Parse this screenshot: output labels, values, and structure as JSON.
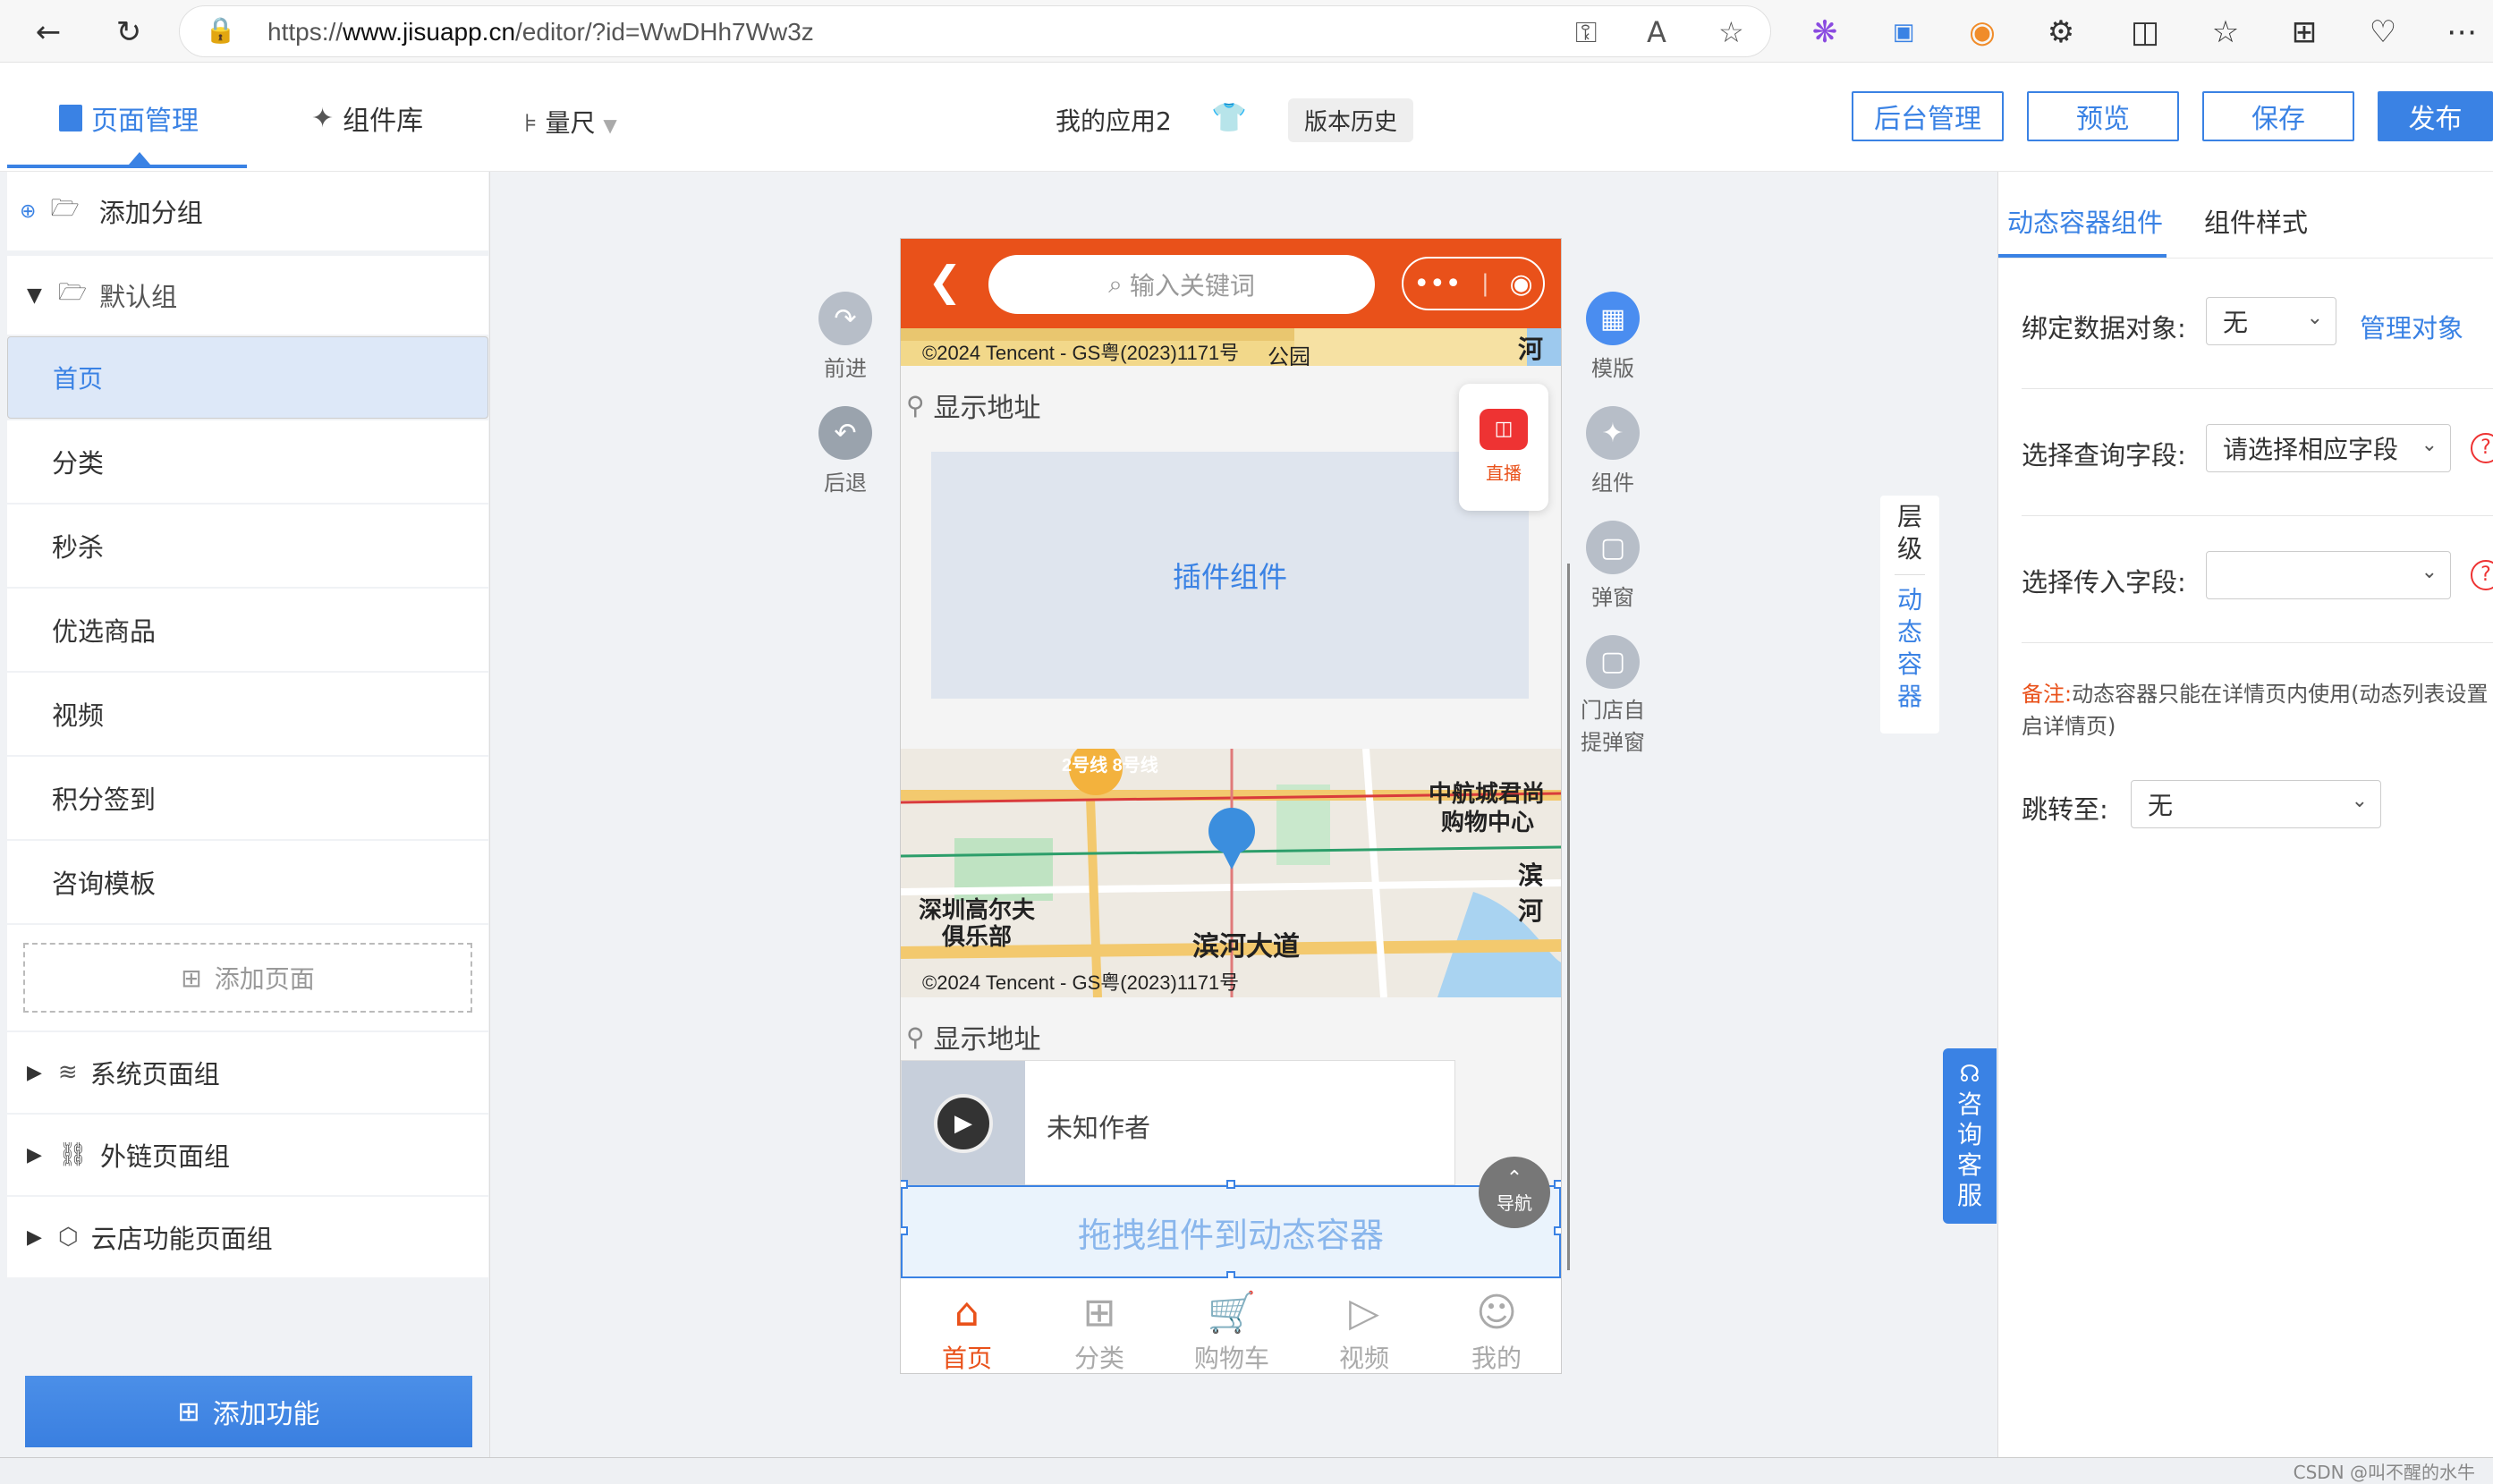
{
  "browser": {
    "url_prefix": "https://",
    "url_domain": "www.jisuapp.cn",
    "url_path": "/editor/?id=WwDHh7Ww3z"
  },
  "header": {
    "tabs": [
      {
        "label": "页面管理",
        "active": true
      },
      {
        "label": "组件库",
        "active": false
      }
    ],
    "ruler_label": "量尺",
    "app_name": "我的应用2",
    "version_history": "版本历史",
    "buttons": {
      "admin": "后台管理",
      "preview": "预览",
      "save": "保存",
      "publish": "发布"
    }
  },
  "left_panel": {
    "add_group": "添加分组",
    "default_group": "默认组",
    "pages": [
      "首页",
      "分类",
      "秒杀",
      "优选商品",
      "视频",
      "积分签到",
      "咨询模板"
    ],
    "selected_page": "首页",
    "add_page": "添加页面",
    "groups": [
      "系统页面组",
      "外链页面组",
      "云店功能页面组"
    ],
    "add_function": "添加功能"
  },
  "canvas": {
    "forward": "前进",
    "back": "后退",
    "template": "模版",
    "component": "组件",
    "popup": "弹窗",
    "store_popup_line1": "门店自",
    "store_popup_line2": "提弹窗",
    "layer": "层级",
    "dynamic_container_vertical": "动态容器",
    "consult_service": "咨询客服"
  },
  "phone": {
    "search_placeholder": "输入关键词",
    "map_copyright": "©2024 Tencent - GS粤(2023)1171号",
    "show_address": "显示地址",
    "plugin_component": "插件组件",
    "live_label": "直播",
    "map_labels": {
      "metro": "2号线 8号线",
      "mall_1": "中航城君尚",
      "mall_2": "购物中心",
      "golf_1": "深圳高尔夫",
      "golf_2": "俱乐部",
      "road": "滨河大道",
      "edge_right": "滨河",
      "edge_top": "河",
      "park": "公园"
    },
    "video_author": "未知作者",
    "dropzone": "拖拽组件到动态容器",
    "nav_label": "导航",
    "tabbar": [
      {
        "label": "首页",
        "icon": "home-icon",
        "active": true
      },
      {
        "label": "分类",
        "icon": "grid-icon",
        "active": false
      },
      {
        "label": "购物车",
        "icon": "cart-icon",
        "active": false
      },
      {
        "label": "视频",
        "icon": "video-icon",
        "active": false
      },
      {
        "label": "我的",
        "icon": "user-icon",
        "active": false
      }
    ]
  },
  "right_panel": {
    "tabs": [
      "动态容器组件",
      "组件样式"
    ],
    "bind_label": "绑定数据对象:",
    "bind_value": "无",
    "manage_object": "管理对象",
    "query_field_label": "选择查询字段:",
    "query_field_value": "请选择相应字段",
    "pass_field_label": "选择传入字段:",
    "pass_field_value": "",
    "note_label": "备注:",
    "note_text": "动态容器只能在详情页内使用(动态列表设置启详情页)",
    "jump_label": "跳转至:",
    "jump_value": "无"
  },
  "footer": {
    "watermark": "CSDN @叫不醒的水牛"
  },
  "colors": {
    "accent": "#3a82e4",
    "phone_header": "#e9511a"
  }
}
